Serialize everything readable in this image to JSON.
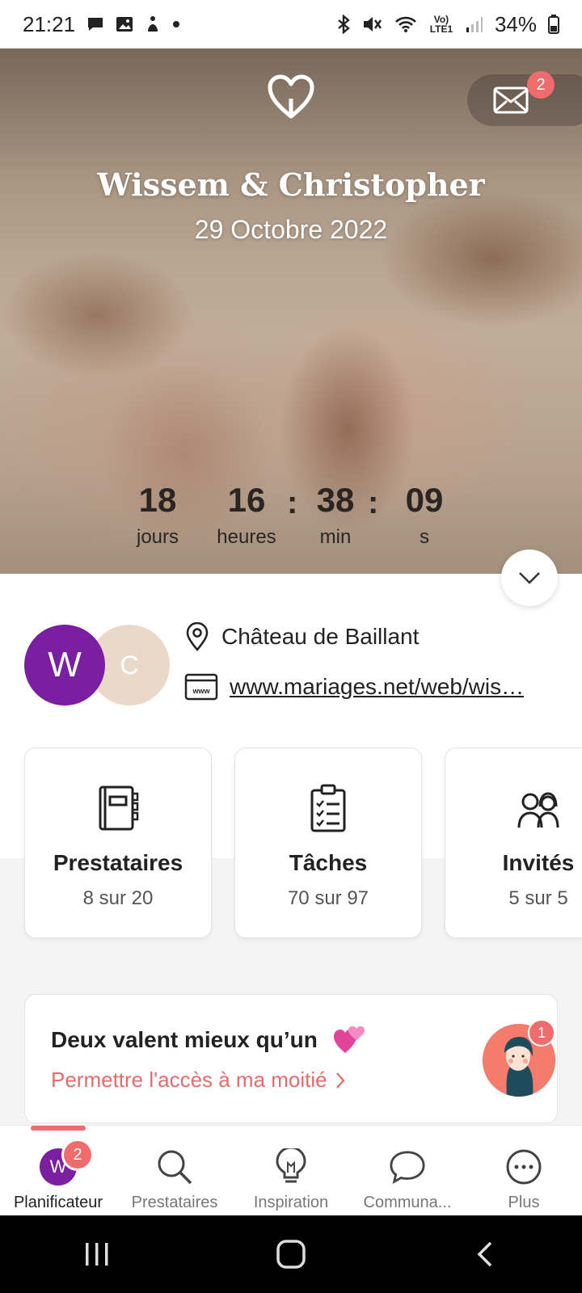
{
  "status_bar": {
    "time": "21:21",
    "battery": "34%",
    "network": "Vo) LTE1"
  },
  "hero": {
    "couple_name": "Wissem & Christopher",
    "date": "29 Octobre 2022",
    "mail_badge": "2",
    "countdown": [
      {
        "value": "18",
        "label": "jours"
      },
      {
        "value": "16",
        "label": "heures"
      },
      {
        "value": "38",
        "label": "min"
      },
      {
        "value": "09",
        "label": "s"
      }
    ],
    "separator": ":"
  },
  "couple": {
    "avatar_1": "W",
    "avatar_2": "C",
    "venue": "Château de Baillant",
    "website": "www.mariages.net/web/wis…",
    "website_icon_text": "www"
  },
  "cards": [
    {
      "title": "Prestataires",
      "subtitle": "8 sur 20",
      "icon": "vendor-notebook-icon"
    },
    {
      "title": "Tâches",
      "subtitle": "70 sur 97",
      "icon": "checklist-icon"
    },
    {
      "title": "Invités",
      "subtitle": "5 sur 5",
      "icon": "guests-icon"
    }
  ],
  "partner_banner": {
    "title": "Deux valent mieux qu’un",
    "link": "Permettre l'accès à ma moitié",
    "badge": "1"
  },
  "bottom_nav": {
    "items": [
      {
        "label": "Planificateur",
        "avatar": "W",
        "badge": "2"
      },
      {
        "label": "Prestataires"
      },
      {
        "label": "Inspiration"
      },
      {
        "label": "Communa..."
      },
      {
        "label": "Plus"
      }
    ]
  },
  "colors": {
    "accent": "#f06b6b",
    "avatar_purple": "#7a1fa2",
    "avatar_beige": "#ead9c8"
  }
}
